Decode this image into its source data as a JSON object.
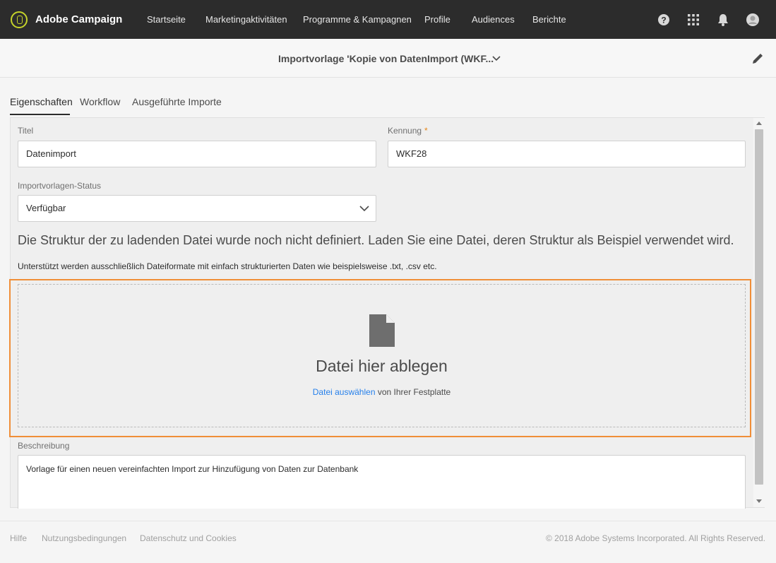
{
  "app": {
    "brand": "Adobe Campaign",
    "nav": [
      "Startseite",
      "Marketingaktivitäten",
      "Programme & Kampagnen",
      "Profile",
      "Audiences",
      "Berichte"
    ],
    "icons": [
      "help-icon",
      "apps-grid-icon",
      "bell-icon",
      "avatar"
    ],
    "accent_logo_color": "#c6d42a"
  },
  "page": {
    "title": "Importvorlage 'Kopie von DatenImport (WKF..."
  },
  "tabs": [
    {
      "label": "Eigenschaften",
      "active": true
    },
    {
      "label": "Workflow",
      "active": false
    },
    {
      "label": "Ausgeführte Importe",
      "active": false
    }
  ],
  "form": {
    "title_label": "Titel",
    "title_value": "Datenimport",
    "id_label": "Kennung",
    "id_required": "*",
    "id_value": "WKF28",
    "status_label": "Importvorlagen-Status",
    "status_value": "Verfügbar",
    "info_big": "Die Struktur der zu ladenden Datei wurde noch nicht definiert. Laden Sie eine Datei, deren Struktur als Beispiel verwendet wird.",
    "info_small": "Unterstützt werden ausschließlich Dateiformate mit einfach strukturierten Daten wie beispielsweise .txt, .csv etc.",
    "drop_title": "Datei hier ablegen",
    "drop_link": "Datei auswählen",
    "drop_suffix": " von Ihrer Festplatte",
    "desc_label": "Beschreibung",
    "desc_value": "Vorlage für einen neuen vereinfachten Import zur Hinzufügung von Daten zur Datenbank"
  },
  "footer": {
    "links": [
      "Hilfe",
      "Nutzungsbedingungen",
      "Datenschutz und Cookies"
    ],
    "copyright": "© 2018 Adobe Systems Incorporated. All Rights Reserved."
  },
  "colors": {
    "highlight": "#f08e38",
    "link": "#2680eb"
  }
}
